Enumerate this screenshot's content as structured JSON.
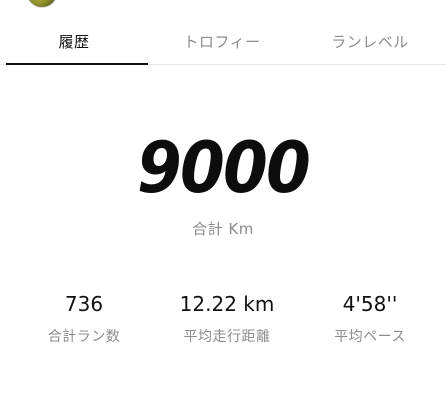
{
  "tabs": [
    {
      "label": "履歴",
      "active": true
    },
    {
      "label": "トロフィー",
      "active": false
    },
    {
      "label": "ランレベル",
      "active": false
    }
  ],
  "summary": {
    "total_distance": "9000",
    "total_distance_label": "合計 Km"
  },
  "stats": [
    {
      "value": "736",
      "label": "合計ラン数"
    },
    {
      "value": "12.22 km",
      "label": "平均走行距離"
    },
    {
      "value": "4'58''",
      "label": "平均ペース"
    }
  ],
  "colors": {
    "primary_text": "#111111",
    "secondary_text": "#8c8c8c",
    "tab_indicator": "#111111",
    "divider": "#e6e6e6"
  }
}
